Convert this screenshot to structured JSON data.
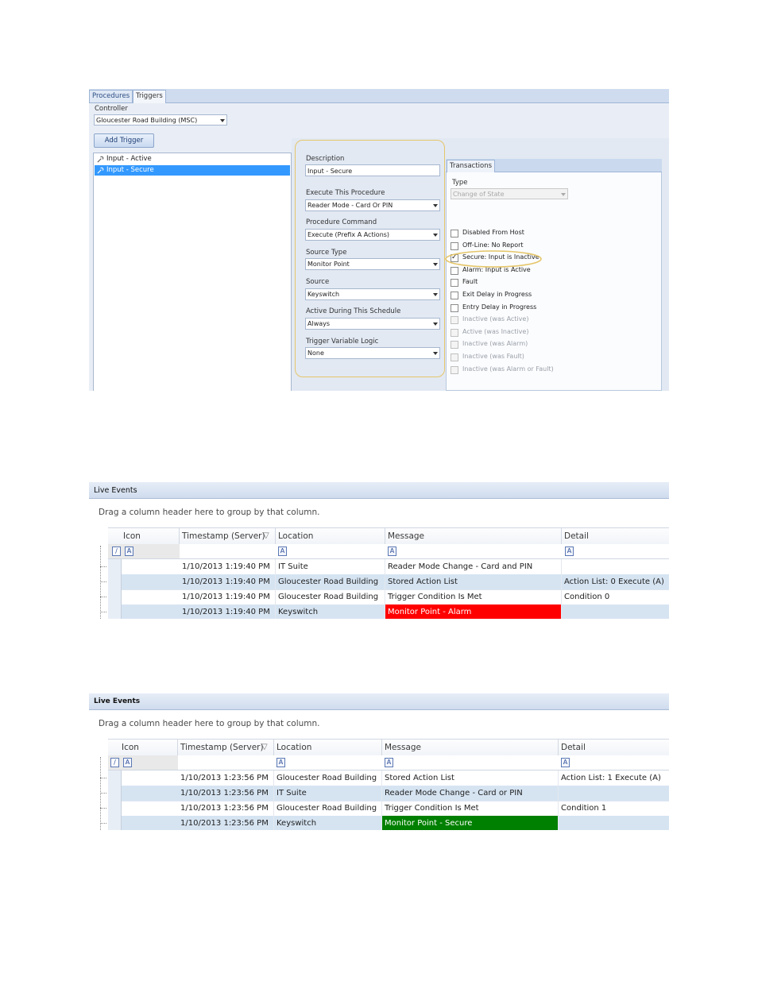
{
  "triggers_panel": {
    "tabs": [
      "Procedures",
      "Triggers"
    ],
    "active_tab": "Triggers",
    "controller_label": "Controller",
    "controller_value": "Gloucester Road Building (MSC)",
    "add_trigger_label": "Add Trigger",
    "trigger_list": [
      "Input - Active",
      "Input - Secure"
    ],
    "selected_trigger": "Input - Secure",
    "editor": {
      "description_label": "Description",
      "description_value": "Input - Secure",
      "execute_label": "Execute This Procedure",
      "execute_value": "Reader Mode - Card Or PIN",
      "command_label": "Procedure Command",
      "command_value": "Execute (Prefix A Actions)",
      "source_type_label": "Source Type",
      "source_type_value": "Monitor Point",
      "source_label": "Source",
      "source_value": "Keyswitch",
      "schedule_label": "Active During This Schedule",
      "schedule_value": "Always",
      "logic_label": "Trigger Variable Logic",
      "logic_value": "None"
    },
    "transactions": {
      "tab_label": "Transactions",
      "type_label": "Type",
      "type_value": "Change of State",
      "checkboxes": [
        {
          "label": "Disabled From Host",
          "checked": false,
          "enabled": true
        },
        {
          "label": "Off-Line: No Report",
          "checked": false,
          "enabled": true
        },
        {
          "label": "Secure: Input is Inactive",
          "checked": true,
          "enabled": true
        },
        {
          "label": "Alarm: Input is Active",
          "checked": false,
          "enabled": true
        },
        {
          "label": "Fault",
          "checked": false,
          "enabled": true
        },
        {
          "label": "Exit Delay in Progress",
          "checked": false,
          "enabled": true
        },
        {
          "label": "Entry Delay in Progress",
          "checked": false,
          "enabled": true
        },
        {
          "label": "Inactive (was Active)",
          "checked": false,
          "enabled": false
        },
        {
          "label": "Active (was Inactive)",
          "checked": false,
          "enabled": false
        },
        {
          "label": "Inactive (was Alarm)",
          "checked": false,
          "enabled": false
        },
        {
          "label": "Inactive (was Fault)",
          "checked": false,
          "enabled": false
        },
        {
          "label": "Inactive (was Alarm or Fault)",
          "checked": false,
          "enabled": false
        }
      ]
    }
  },
  "live_events_1": {
    "title": "Live Events",
    "group_hint": "Drag a column header here to group by that column.",
    "columns": [
      "Icon",
      "Timestamp (Server)",
      "Location",
      "Message",
      "Detail"
    ],
    "filter_glyph": "A",
    "rows": [
      {
        "timestamp": "1/10/2013 1:19:40 PM",
        "location": "IT Suite",
        "message": "Reader Mode Change - Card and PIN",
        "detail": ""
      },
      {
        "timestamp": "1/10/2013 1:19:40 PM",
        "location": "Gloucester Road Building",
        "message": "Stored Action List",
        "detail": "Action List: 0  Execute (A)"
      },
      {
        "timestamp": "1/10/2013 1:19:40 PM",
        "location": "Gloucester Road Building",
        "message": "Trigger Condition Is Met",
        "detail": "Condition 0"
      },
      {
        "timestamp": "1/10/2013 1:19:40 PM",
        "location": "Keyswitch",
        "message": "Monitor Point - Alarm",
        "detail": "",
        "message_bg": "#ff0000"
      }
    ]
  },
  "live_events_2": {
    "title": "Live Events",
    "group_hint": "Drag a column header here to group by that column.",
    "columns": [
      "Icon",
      "Timestamp (Server)",
      "Location",
      "Message",
      "Detail"
    ],
    "filter_glyph": "A",
    "rows": [
      {
        "timestamp": "1/10/2013 1:23:56 PM",
        "location": "Gloucester Road Building",
        "message": "Stored Action List",
        "detail": "Action List: 1  Execute (A)"
      },
      {
        "timestamp": "1/10/2013 1:23:56 PM",
        "location": "IT Suite",
        "message": "Reader Mode Change - Card or PIN",
        "detail": ""
      },
      {
        "timestamp": "1/10/2013 1:23:56 PM",
        "location": "Gloucester Road Building",
        "message": "Trigger Condition Is Met",
        "detail": "Condition 1"
      },
      {
        "timestamp": "1/10/2013 1:23:56 PM",
        "location": "Keyswitch",
        "message": "Monitor Point - Secure",
        "detail": "",
        "message_bg": "#008000"
      }
    ]
  },
  "colors": {
    "selection": "#3399ff",
    "highlight_ring": "#e5c66a",
    "alarm": "#ff0000",
    "secure": "#008000"
  }
}
